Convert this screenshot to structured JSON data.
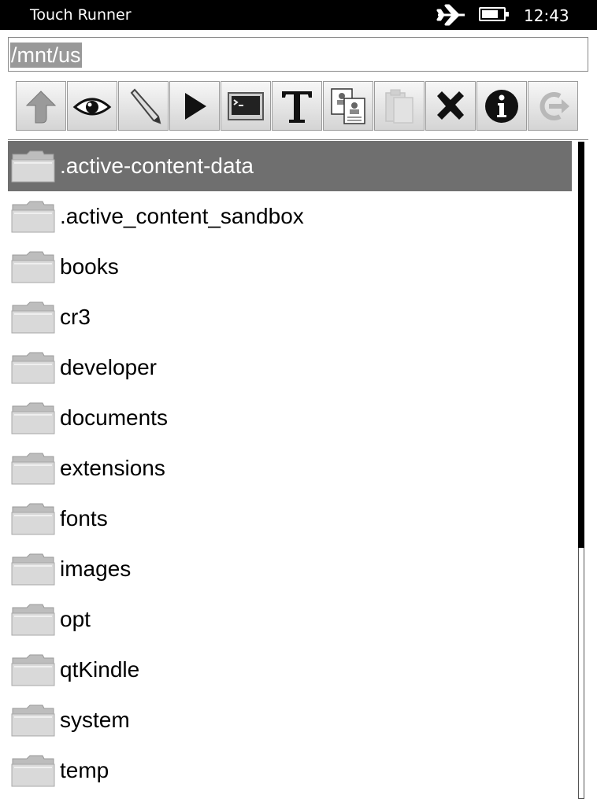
{
  "status": {
    "app_title": "Touch Runner",
    "time": "12:43",
    "airplane_icon": "airplane-icon",
    "battery_icon": "battery-icon",
    "battery_level": 0.75
  },
  "path": {
    "value": "/mnt/us"
  },
  "toolbar": [
    {
      "name": "up-button",
      "icon": "up-arrow-icon"
    },
    {
      "name": "view-button",
      "icon": "eye-icon"
    },
    {
      "name": "edit-button",
      "icon": "pencil-icon"
    },
    {
      "name": "run-button",
      "icon": "play-icon"
    },
    {
      "name": "terminal-button",
      "icon": "terminal-icon"
    },
    {
      "name": "text-button",
      "icon": "text-icon"
    },
    {
      "name": "copy-button",
      "icon": "copy-icon"
    },
    {
      "name": "paste-button",
      "icon": "paste-icon"
    },
    {
      "name": "delete-button",
      "icon": "delete-icon"
    },
    {
      "name": "info-button",
      "icon": "info-icon"
    },
    {
      "name": "exit-button",
      "icon": "exit-icon"
    }
  ],
  "files": [
    {
      "name": ".active-content-data",
      "selected": true
    },
    {
      "name": ".active_content_sandbox"
    },
    {
      "name": "books"
    },
    {
      "name": "cr3"
    },
    {
      "name": "developer"
    },
    {
      "name": "documents"
    },
    {
      "name": "extensions"
    },
    {
      "name": "fonts"
    },
    {
      "name": "images"
    },
    {
      "name": "opt"
    },
    {
      "name": "qtKindle"
    },
    {
      "name": "system"
    },
    {
      "name": "temp"
    }
  ],
  "colors": {
    "selection": "#6f6f6f",
    "statusbar": "#000000"
  }
}
